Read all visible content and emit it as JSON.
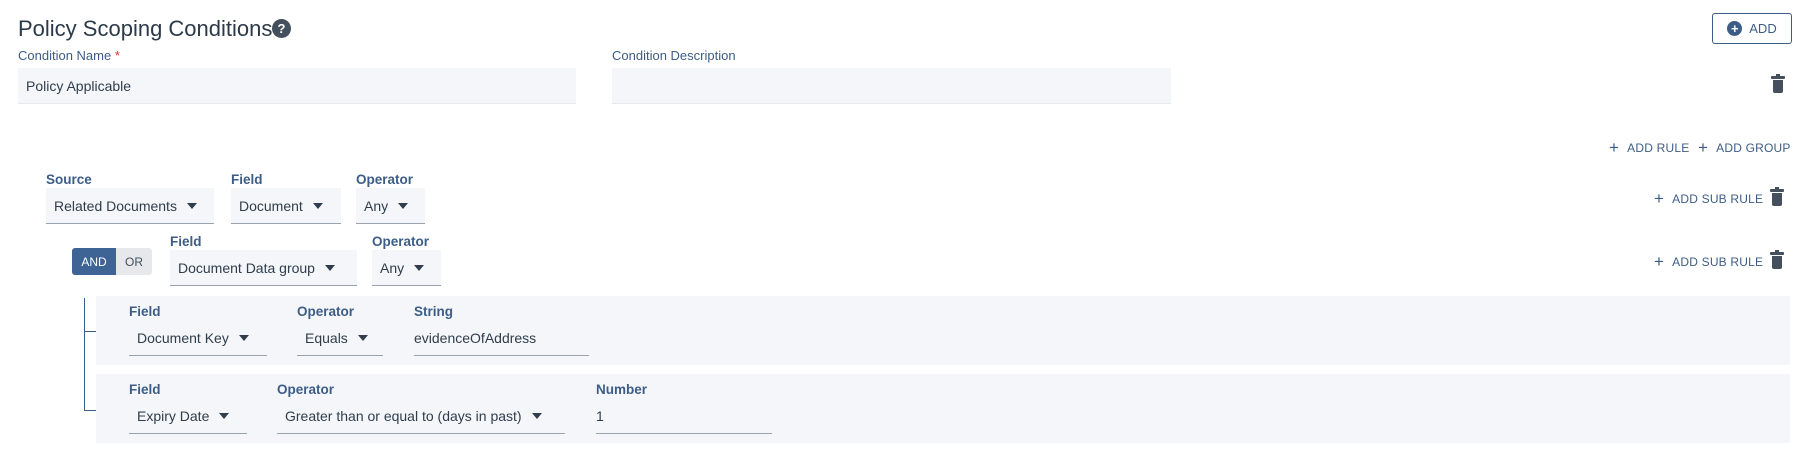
{
  "header": {
    "title": "Policy Scoping Conditions",
    "help_glyph": "?",
    "add_label": "ADD"
  },
  "condition": {
    "name_label": "Condition Name",
    "required_mark": "*",
    "name_value": "Policy Applicable",
    "description_label": "Condition Description",
    "description_value": ""
  },
  "actions": {
    "add_rule": "ADD RULE",
    "add_group": "ADD GROUP",
    "add_sub_rule": "ADD SUB RULE"
  },
  "rule1": {
    "source_label": "Source",
    "source_value": "Related Documents",
    "field_label": "Field",
    "field_value": "Document",
    "operator_label": "Operator",
    "operator_value": "Any"
  },
  "group": {
    "and_label": "AND",
    "or_label": "OR",
    "selected": "AND",
    "field_label": "Field",
    "field_value": "Document Data group",
    "operator_label": "Operator",
    "operator_value": "Any"
  },
  "sub_rules": [
    {
      "field_label": "Field",
      "field_value": "Document Key",
      "operator_label": "Operator",
      "operator_value": "Equals",
      "value_label": "String",
      "value": "evidenceOfAddress"
    },
    {
      "field_label": "Field",
      "field_value": "Expiry Date",
      "operator_label": "Operator",
      "operator_value": "Greater than or equal to (days in past)",
      "value_label": "Number",
      "value": "1"
    }
  ],
  "colors": {
    "accent": "#3d5d86",
    "toggle_active": "#3d6494",
    "required": "#d9342b",
    "field_bg": "#f4f6f9"
  },
  "icons": [
    "help-icon",
    "plus-circle-icon",
    "trash-icon",
    "plus-icon",
    "caret-down-icon"
  ]
}
